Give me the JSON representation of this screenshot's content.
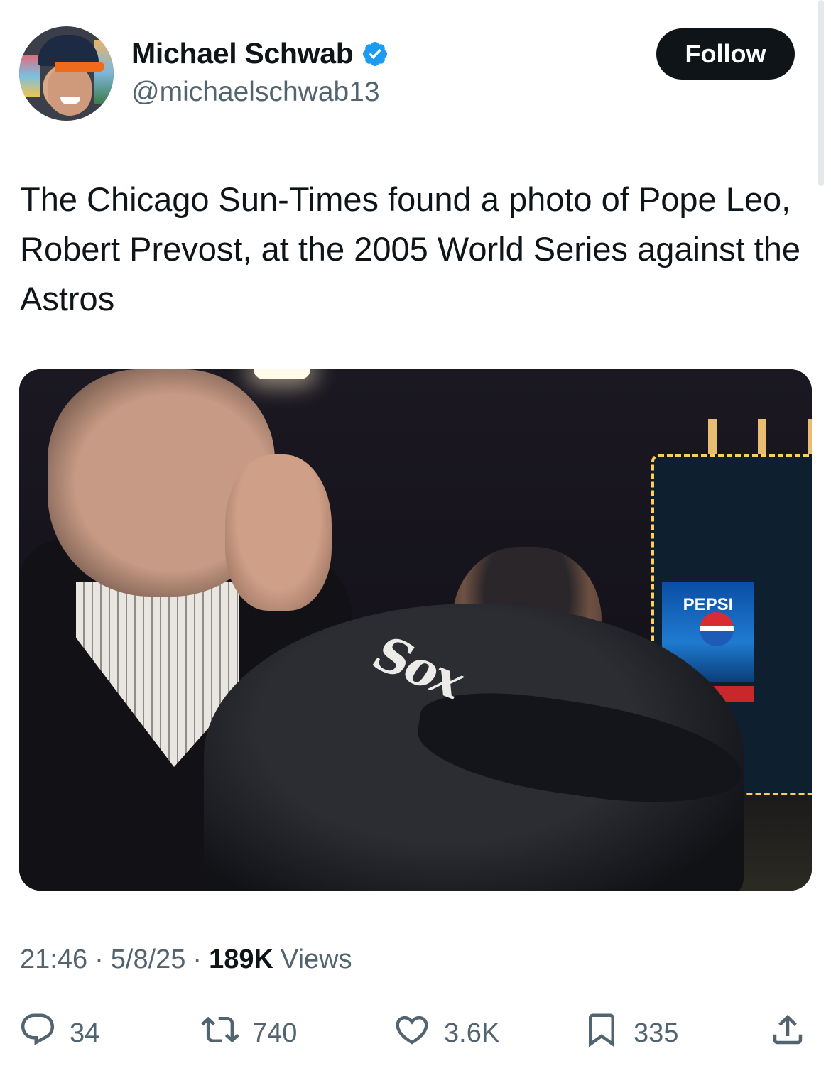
{
  "author": {
    "display_name": "Michael Schwab",
    "handle": "@michaelschwab13",
    "verified": true
  },
  "follow_button": {
    "label": "Follow"
  },
  "tweet": {
    "text": "The Chicago Sun-Times found a photo of Pope Leo, Robert Prevost, at the 2005 World Series against the Astros"
  },
  "photo": {
    "sign_text": "PEPSI"
  },
  "meta": {
    "time": "21:46",
    "date": "5/8/25",
    "views_count": "189K",
    "views_label": "Views",
    "separator": "·"
  },
  "actions": {
    "reply_count": "34",
    "retweet_count": "740",
    "like_count": "3.6K",
    "bookmark_count": "335"
  },
  "colors": {
    "text_primary": "#0f1419",
    "text_secondary": "#536471",
    "verified_blue": "#1d9bf0",
    "follow_button_bg": "#0f1419"
  }
}
